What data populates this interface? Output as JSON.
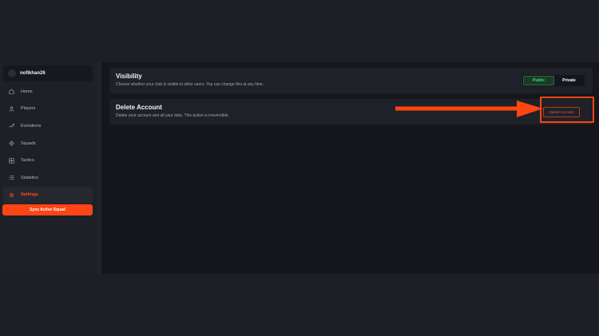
{
  "sidebar": {
    "username": "nofikhan26",
    "items": [
      {
        "label": "Home",
        "icon": "home-icon",
        "active": false
      },
      {
        "label": "Players",
        "icon": "person-icon",
        "active": false
      },
      {
        "label": "Evolutions",
        "icon": "evolution-icon",
        "active": false
      },
      {
        "label": "Squads",
        "icon": "squads-icon",
        "active": false
      },
      {
        "label": "Tactics",
        "icon": "grid-icon",
        "active": false
      },
      {
        "label": "Statistics",
        "icon": "list-icon",
        "active": false
      },
      {
        "label": "Settings",
        "icon": "gear-icon",
        "active": true
      }
    ],
    "sync_label": "Sync Active Squad"
  },
  "settings": {
    "visibility": {
      "title": "Visibility",
      "description": "Choose whether your club is visible to other users. You can change this at any time.",
      "options": [
        "Public",
        "Private"
      ],
      "selected": "Public"
    },
    "delete_account": {
      "title": "Delete Account",
      "description": "Delete your account and all your data. This action is irreversible.",
      "button_label": "Delete Account"
    }
  },
  "colors": {
    "accent": "#ff4514",
    "public_active": "#3ddc6b",
    "danger": "#e0574a"
  }
}
